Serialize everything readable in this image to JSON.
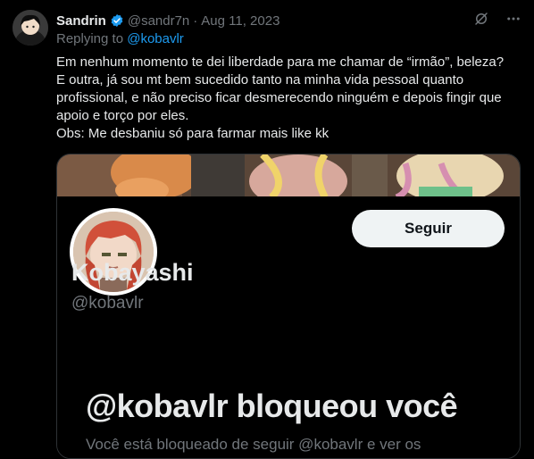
{
  "tweet": {
    "author_name": "Sandrin",
    "author_handle": "@sandr7n",
    "separator": "·",
    "date": "Aug 11, 2023",
    "replying_prefix": "Replying to",
    "replying_mention": "@kobavlr",
    "text_lines": [
      "Em nenhum momento te dei liberdade para me chamar de “irmão”, beleza? E outra, já sou mt bem sucedido tanto na minha vida pessoal quanto profissional, e não preciso ficar desmerecendo ninguém e depois fingir que apoio e torço por eles.",
      "Obs: Me desbaniu só para farmar mais like kk"
    ],
    "icons": {
      "verified": "verified-badge-icon",
      "grok": "grok-icon",
      "more": "more-options-icon"
    },
    "accent_color": "#1d9bf0"
  },
  "embedded_profile": {
    "name": "Kobayashi",
    "handle": "@kobavlr",
    "follow_label": "Seguir",
    "blocked_title": "@kobavlr bloqueou você",
    "blocked_subtitle_partial": "Você está bloqueado de seguir @kobavlr e ver os"
  }
}
